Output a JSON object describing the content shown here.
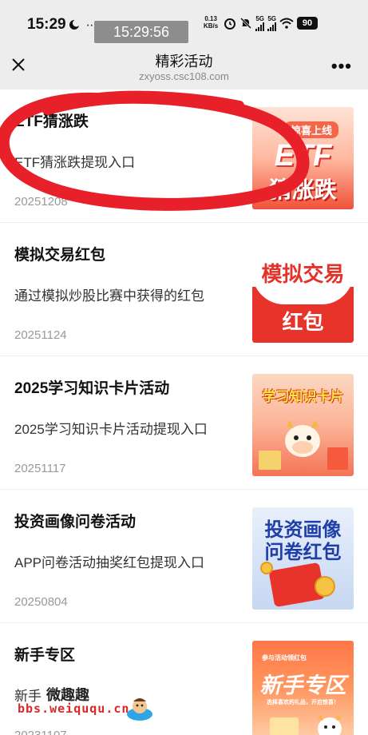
{
  "status_bar": {
    "time": "15:29",
    "overlay_time": "15:29:56",
    "net_speed": "0.13",
    "net_unit": "KB/s",
    "sig1_label": "5G",
    "sig2_label": "5G",
    "battery": "90",
    "icons": [
      "moon-icon",
      "dots-icon",
      "alarm-icon",
      "mute-icon",
      "signal-icon",
      "wifi-icon",
      "battery-icon"
    ]
  },
  "header": {
    "title": "精彩活动",
    "domain": "zxyoss.csc108.com",
    "close_icon": "close-icon",
    "more_icon": "more-icon",
    "more_label": "•••"
  },
  "activities": [
    {
      "title": "ETF猜涨跌",
      "description": "ETF猜涨跌提现入口",
      "date": "20251208",
      "thumb_line1": "惊喜上线",
      "thumb_line2": "ETF",
      "thumb_line3": "猜涨跌"
    },
    {
      "title": "模拟交易红包",
      "description": "通过模拟炒股比赛中获得的红包",
      "date": "20251124",
      "thumb_line1": "模拟交易",
      "thumb_line2": "红包"
    },
    {
      "title": "2025学习知识卡片活动",
      "description": "2025学习知识卡片活动提现入口",
      "date": "20251117",
      "thumb_line1": "学习知识卡片"
    },
    {
      "title": "投资画像问卷活动",
      "description": "APP问卷活动抽奖红包提现入口",
      "date": "20250804",
      "thumb_line1": "投资画像",
      "thumb_line2": "问卷红包"
    },
    {
      "title": "新手专区",
      "description": "新手",
      "date": "20231107",
      "thumb_line1": "参与活动领红包",
      "thumb_line2": "新手专区",
      "thumb_line3": "选择喜欢的礼品，开启惊喜！"
    }
  ],
  "watermark": {
    "cn": "微趣趣",
    "url": "bbs.weiququ.cn"
  },
  "colors": {
    "header_bg": "#ededed",
    "scribble": "#e8202a",
    "watermark": "#d8282a"
  }
}
